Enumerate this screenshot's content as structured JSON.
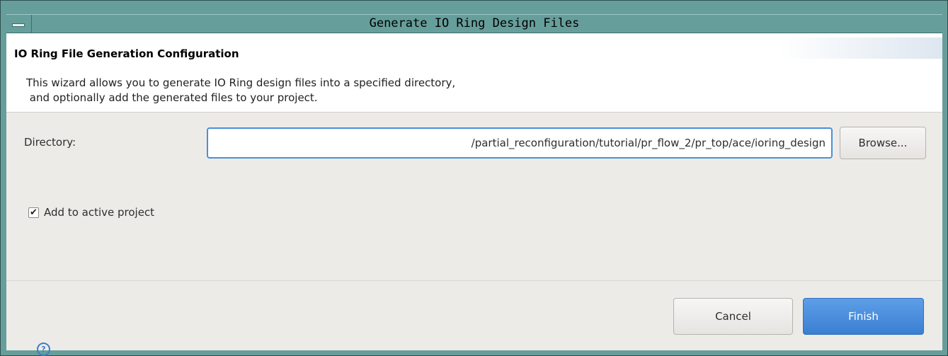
{
  "window": {
    "title": "Generate IO Ring Design Files"
  },
  "header": {
    "title": "IO Ring File Generation Configuration",
    "description": "This wizard allows you to generate IO Ring design files into a specified directory,\n and optionally add the generated files to your project."
  },
  "form": {
    "directory_label": "Directory:",
    "directory_value": "/partial_reconfiguration/tutorial/pr_flow_2/pr_top/ace/ioring_design",
    "browse_label": "Browse...",
    "add_to_project_label": "Add to active project",
    "add_to_project_checked": true
  },
  "footer": {
    "cancel_label": "Cancel",
    "finish_label": "Finish"
  },
  "colors": {
    "accent": "#3a7fd2",
    "frame": "#669e9b"
  }
}
